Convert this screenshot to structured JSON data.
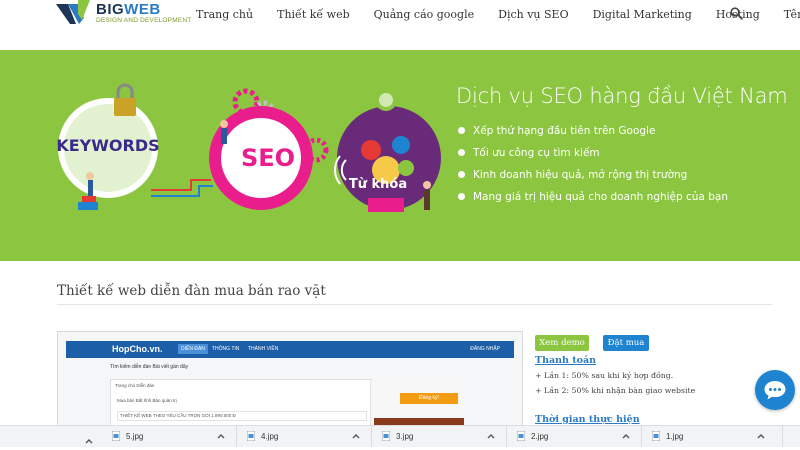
{
  "brand": {
    "name_prefix": "BIG",
    "name_suffix": "WEB",
    "tagline": "DESIGN AND DEVELOPMENT",
    "colors": {
      "dark": "#1d3557",
      "blue": "#2a7bc4",
      "green": "#8cc641"
    }
  },
  "nav": {
    "items": [
      {
        "label": "Trang chủ"
      },
      {
        "label": "Thiết kế web"
      },
      {
        "label": "Quảng cáo google"
      },
      {
        "label": "Dịch vụ SEO"
      },
      {
        "label": "Digital Marketing"
      },
      {
        "label": "Hosting"
      },
      {
        "label": "Tên miền"
      }
    ],
    "search_icon": "search-icon"
  },
  "banner": {
    "title": "Dịch vụ SEO hàng đầu Việt Nam",
    "bullets": [
      "Xếp thứ hạng đầu tiên trên Google",
      "Tối ưu công cụ tìm kiếm",
      "Kinh doanh hiệu quả, mở rộng thị trường",
      "Mang giá trị hiệu quả cho doanh nghiệp của bạn"
    ],
    "art": {
      "keywords": "KEYWORDS",
      "seo": "SEO",
      "tukhoa": "Từ khóa"
    },
    "background": "#8cc641"
  },
  "section": {
    "title": "Thiết kế web diễn đàn mua bán rao vặt"
  },
  "preview": {
    "logo": "HopCho.vn.",
    "tabs": [
      "DIỄN ĐÀN",
      "THÔNG TIN",
      "THÀNH VIÊN"
    ],
    "login": "ĐĂNG NHẬP",
    "crumbs": "Tìm kiếm diễn đàn     Bài viết gần đây",
    "panel_tabs": "Trang chủ     Diễn đàn",
    "panel_buttons": "Mua bán     Bất tĩnh     Bàn quản trị",
    "row_text": "THIẾT KẾ WEB THEO YÊU CẦU TRỌN GÓI 1.990.000 Đ",
    "register": "Đăng ký!"
  },
  "product": {
    "demo_label": "Xem demo",
    "buy_label": "Đặt mua",
    "payment_title": "Thanh toán",
    "payment_lines": [
      "+ Lần 1: 50% sau khi ký hợp đồng.",
      "+ Lần 2: 50% khi nhận bàn giao website"
    ],
    "time_title": "Thời gian thực hiện"
  },
  "chat": {
    "icon": "chat-icon",
    "color": "#1e84d0"
  },
  "downloads": {
    "items": [
      {
        "name": "5.jpg"
      },
      {
        "name": "4.jpg"
      },
      {
        "name": "3.jpg"
      },
      {
        "name": "2.jpg"
      },
      {
        "name": "1.jpg"
      }
    ]
  }
}
